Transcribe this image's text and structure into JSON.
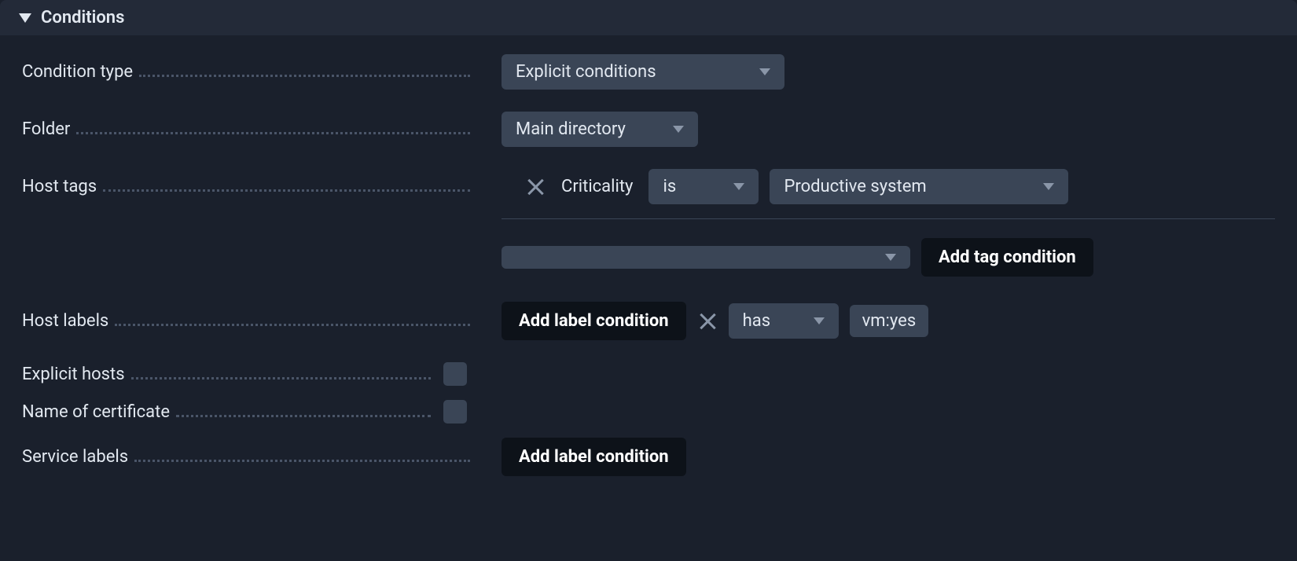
{
  "header": {
    "title": "Conditions"
  },
  "rows": {
    "condition_type": {
      "label": "Condition type",
      "value": "Explicit conditions"
    },
    "folder": {
      "label": "Folder",
      "value": "Main directory"
    },
    "host_tags": {
      "label": "Host tags",
      "tag_group": "Criticality",
      "operator": "is",
      "tag_value": "Productive system",
      "add_button": "Add tag condition"
    },
    "host_labels": {
      "label": "Host labels",
      "add_button": "Add label condition",
      "operator": "has",
      "label_value": "vm:yes"
    },
    "explicit_hosts": {
      "label": "Explicit hosts"
    },
    "name_of_certificate": {
      "label": "Name of certificate"
    },
    "service_labels": {
      "label": "Service labels",
      "add_button": "Add label condition"
    }
  }
}
